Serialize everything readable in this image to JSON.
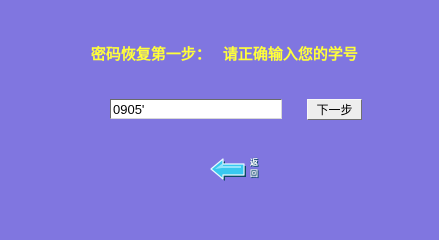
{
  "page": {
    "title_part1": "密码恢复第一步：",
    "title_part2": "请正确输入您的学号"
  },
  "form": {
    "student_id_value": "0905'",
    "next_button_label": "下一步"
  },
  "back_link": {
    "icon": "back-arrow-icon",
    "label_top": "返",
    "label_bottom": "回"
  },
  "colors": {
    "background": "#8076e0",
    "title": "#ffff3a",
    "arrow_fill": "#38c8f0",
    "arrow_outline": "#0a4a66"
  }
}
